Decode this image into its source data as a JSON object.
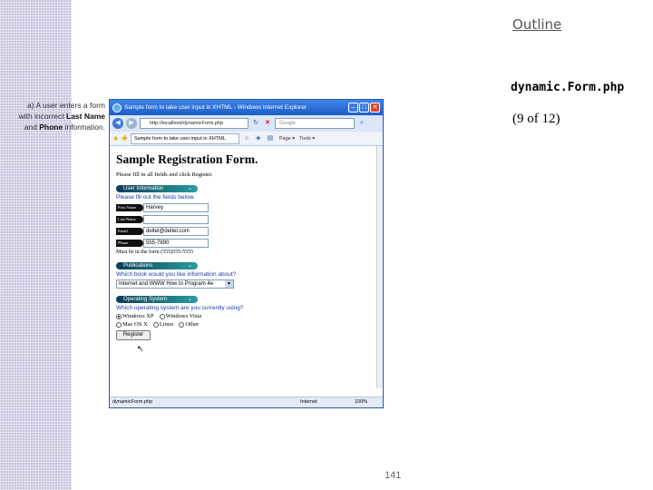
{
  "slide": {
    "outline_link": "Outline",
    "file_name": "dynamic.Form.php",
    "counter": "(9 of 12)",
    "caption_part1": "a) A user enters a form with incorrect ",
    "caption_bold1": "Last Name",
    "caption_part2": " and ",
    "caption_bold2": "Phone",
    "caption_part3": " information.",
    "page_number": "141"
  },
  "browser": {
    "title": "Sample form to take user input in XHTML - Windows Internet Explorer",
    "address": "http://localhost/dynamicForm.php",
    "search_placeholder": "Google",
    "tab_label": "Sample form to take user input in XHTML",
    "commands": [
      "Page ▾",
      "Tools ▾"
    ],
    "status_left": "dynamicForm.php",
    "status_zone": "Internet",
    "status_zoom": "100%"
  },
  "form": {
    "heading": "Sample Registration Form.",
    "intro": "Please fill in all fields and click Register.",
    "user_section": "User Information",
    "user_subhead": "Please fill out the fields below.",
    "fields": [
      {
        "label": "First Name",
        "value": "Harvey"
      },
      {
        "label": "Last Name",
        "value": ""
      },
      {
        "label": "Email",
        "value": "deitel@deitel.com"
      },
      {
        "label": "Phone",
        "value": "555-7890"
      }
    ],
    "phone_hint": "Must be in the form (555)555-5555",
    "pub_section": "Publications",
    "pub_subhead": "Which book would you like information about?",
    "pub_selected": "Internet and WWW How to Program 4e",
    "os_section": "Operating System",
    "os_subhead": "Which operating system are you currently using?",
    "os_options": [
      "Windows XP",
      "Windows Vista",
      "Mac OS X",
      "Linux",
      "Other"
    ],
    "register_label": "Register"
  }
}
